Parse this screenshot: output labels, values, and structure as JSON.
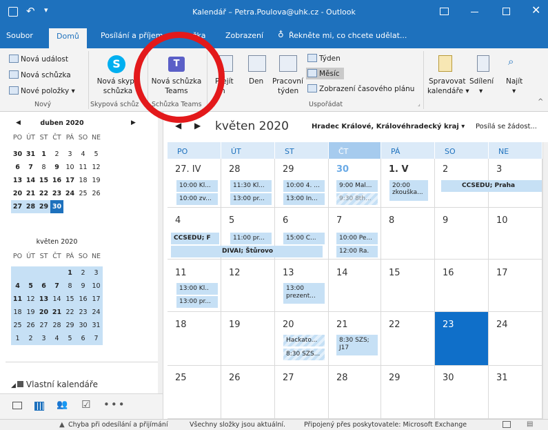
{
  "titlebar": {
    "title": "Kalendář – Petra.Poulova@uhk.cz - Outlook"
  },
  "tabs": [
    "Soubor",
    "Domů",
    "Posílání a příjem",
    "Složka",
    "Zobrazení"
  ],
  "tell_me": "Řekněte mi, co chcete udělat...",
  "ribbon": {
    "new_event": "Nová událost",
    "new_meeting": "Nová schůzka",
    "new_items": "Nové položky",
    "new_group": "Nový",
    "skype_line1": "Nová skype",
    "skype_line2": "schůzka",
    "skype_group": "Skypová schůz",
    "teams_line1": "Nová schůzka",
    "teams_line2": "Teams",
    "teams_group": "Schůzka Teams",
    "today_line1": "Přejít",
    "today_line2": "n",
    "day": "Den",
    "workweek_line1": "Pracovní",
    "workweek_line2": "týden",
    "week": "Týden",
    "month": "Měsíc",
    "schedule": "Zobrazení časového plánu",
    "arrange_group": "Uspořádat",
    "manage_line1": "Spravovat",
    "manage_line2": "kalendáře",
    "share": "Sdílení",
    "find": "Najít"
  },
  "mini_april": {
    "title": "duben 2020",
    "daynames": [
      "PO",
      "ÚT",
      "ST",
      "ČT",
      "PÁ",
      "SO",
      "NE"
    ],
    "rows": [
      [
        "30",
        "31",
        "1",
        "2",
        "3",
        "4",
        "5"
      ],
      [
        "6",
        "7",
        "8",
        "9",
        "10",
        "11",
        "12"
      ],
      [
        "13",
        "14",
        "15",
        "16",
        "17",
        "18",
        "19"
      ],
      [
        "20",
        "21",
        "22",
        "23",
        "24",
        "25",
        "26"
      ],
      [
        "27",
        "28",
        "29",
        "30",
        "",
        "",
        ""
      ]
    ]
  },
  "mini_may": {
    "title": "květen 2020",
    "daynames": [
      "PO",
      "ÚT",
      "ST",
      "ČT",
      "PÁ",
      "SO",
      "NE"
    ],
    "rows": [
      [
        "",
        "",
        "",
        "",
        "1",
        "2",
        "3"
      ],
      [
        "4",
        "5",
        "6",
        "7",
        "8",
        "9",
        "10"
      ],
      [
        "11",
        "12",
        "13",
        "14",
        "15",
        "16",
        "17"
      ],
      [
        "18",
        "19",
        "20",
        "21",
        "22",
        "23",
        "24"
      ],
      [
        "25",
        "26",
        "27",
        "28",
        "29",
        "30",
        "31"
      ],
      [
        "1",
        "2",
        "3",
        "4",
        "5",
        "6",
        "7"
      ]
    ]
  },
  "my_calendars": "Vlastní kalendáře",
  "main": {
    "month_title": "květen 2020",
    "location": "Hradec Králové, Královéhradecký kraj",
    "sending": "Posílá se žádost...",
    "weekdays": [
      "PO",
      "ÚT",
      "ST",
      "ČT",
      "PÁ",
      "SO",
      "NE"
    ],
    "weeks": [
      [
        "27. IV",
        "28",
        "29",
        "30",
        "1. V",
        "2",
        "3"
      ],
      [
        "4",
        "5",
        "6",
        "7",
        "8",
        "9",
        "10"
      ],
      [
        "11",
        "12",
        "13",
        "14",
        "15",
        "16",
        "17"
      ],
      [
        "18",
        "19",
        "20",
        "21",
        "22",
        "23",
        "24"
      ],
      [
        "25",
        "26",
        "27",
        "28",
        "29",
        "30",
        "31"
      ]
    ],
    "events": {
      "w1_mon_a": "10:00 Kl...",
      "w1_mon_b": "10:00 zv...",
      "w1_tue_a": "11:30 Kl...",
      "w1_tue_b": "13:00 pr...",
      "w1_wed_a": "10:00 4. ...",
      "w1_wed_b": "13:00 In...",
      "w1_thu_a": "9:00 Mal...",
      "w1_thu_b": "9:30 8th...",
      "w1_fri_a1": "20:00",
      "w1_fri_a2": "zkouška...",
      "w1_weekend": "CCSEDU; Praha",
      "w2_mon": "CCSEDU; F",
      "w2_tue": "11:00 pr...",
      "w2_wed": "15:00 C...",
      "w2_thu_a": "10:00 Pe...",
      "w2_thu_b": "12:00 Ra.",
      "w2_span": "DIVAI; Štůrovo",
      "w3_mon_a": "13:00 Kl..",
      "w3_mon_b": "13:00 pr...",
      "w3_wed_1": "13:00",
      "w3_wed_2": "prezent...",
      "w4_wed_a": "Hackato...",
      "w4_wed_b": "8:30 SZS...",
      "w4_thu_1": "8:30 SZS;",
      "w4_thu_2": "J17"
    }
  },
  "status": {
    "error": "Chyba při odesílání a přijímání",
    "uptodate": "Všechny složky jsou aktuální.",
    "connected": "Připojený přes poskytovatele: Microsoft Exchange"
  }
}
